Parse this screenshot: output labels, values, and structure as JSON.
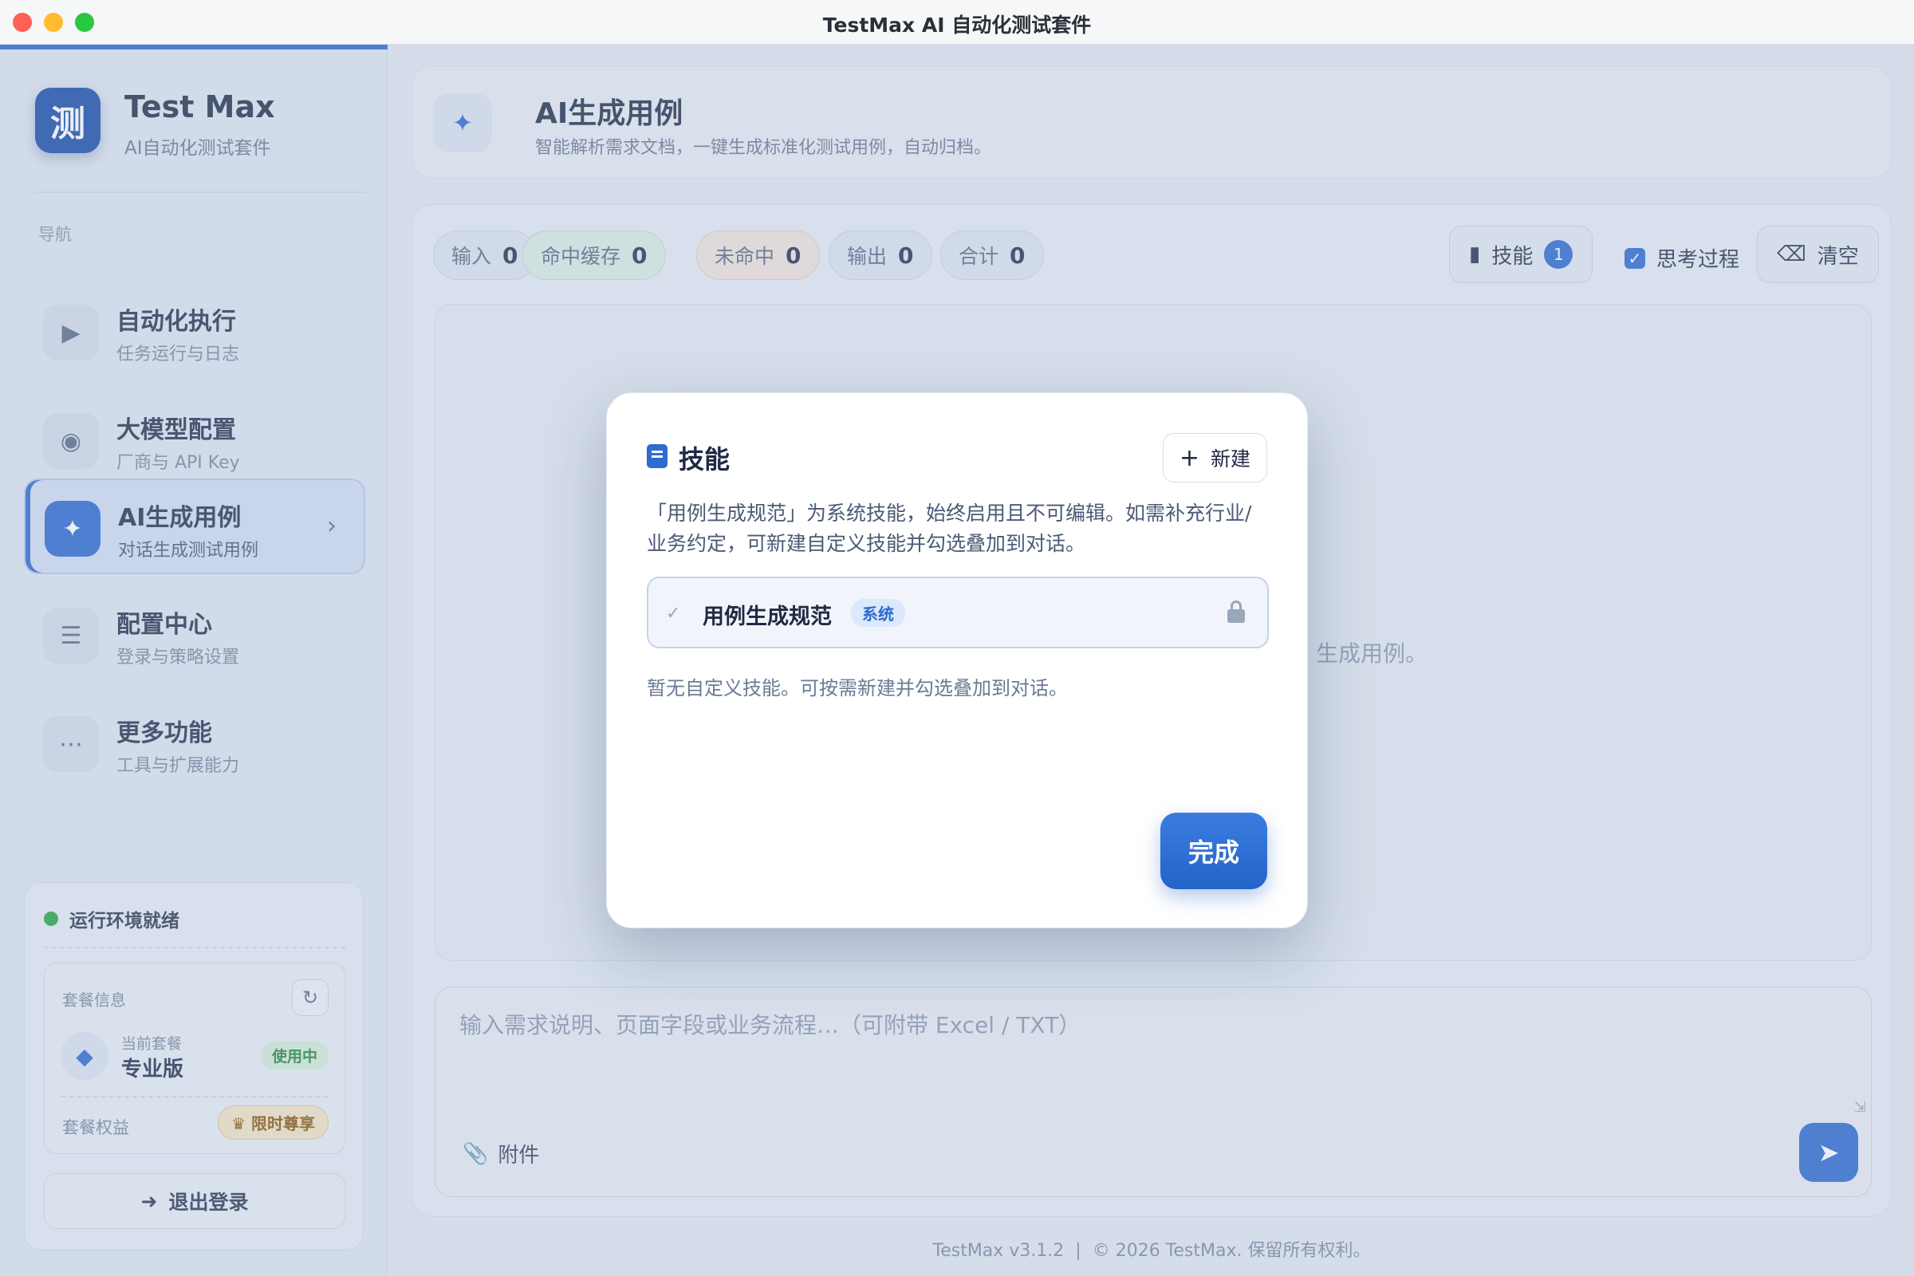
{
  "window": {
    "title": "TestMax AI 自动化测试套件"
  },
  "brand": {
    "logo_glyph": "测",
    "name": "Test Max",
    "subtitle": "AI自动化测试套件"
  },
  "sidebar": {
    "caption": "导航",
    "items": [
      {
        "title": "自动化执行",
        "sub": "任务运行与日志",
        "icon": "play-icon",
        "active": false
      },
      {
        "title": "大模型配置",
        "sub": "厂商与 API Key",
        "icon": "brain-icon",
        "active": false
      },
      {
        "title": "AI生成用例",
        "sub": "对话生成测试用例",
        "icon": "magic-wand-icon",
        "active": true
      },
      {
        "title": "配置中心",
        "sub": "登录与策略设置",
        "icon": "sliders-icon",
        "active": false
      },
      {
        "title": "更多功能",
        "sub": "工具与扩展能力",
        "icon": "more-dots-icon",
        "active": false
      }
    ]
  },
  "status": {
    "text": "运行环境就绪",
    "plan_caption": "套餐信息",
    "plan_label": "当前套餐",
    "plan_value": "专业版",
    "plan_badge": "使用中",
    "benefit_label": "套餐权益",
    "vip_label": "限时尊享",
    "logout_label": "退出登录"
  },
  "header": {
    "title": "AI生成用例",
    "subtitle": "智能解析需求文档，一键生成标准化测试用例，自动归档。"
  },
  "stats": [
    {
      "label": "输入",
      "value": "0"
    },
    {
      "label": "命中缓存",
      "value": "0"
    },
    {
      "label": "未命中",
      "value": "0"
    },
    {
      "label": "输出",
      "value": "0"
    },
    {
      "label": "合计",
      "value": "0"
    }
  ],
  "toolbar": {
    "skills_label": "技能",
    "skills_count": "1",
    "think_label": "思考过程",
    "clear_label": "清空"
  },
  "chat": {
    "hint": "生成用例。"
  },
  "composer": {
    "placeholder": "输入需求说明、页面字段或业务流程…（可附带 Excel / TXT）",
    "attach_label": "附件"
  },
  "footer": {
    "version": "TestMax v3.1.2",
    "copyright": "© 2026 TestMax. 保留所有权利。"
  },
  "modal": {
    "title": "技能",
    "new_label": "新建",
    "description": "「用例生成规范」为系统技能，始终启用且不可编辑。如需补充行业/业务约定，可新建自定义技能并勾选叠加到对话。",
    "skill_name": "用例生成规范",
    "skill_tag": "系统",
    "empty_hint": "暂无自定义技能。可按需新建并勾选叠加到对话。",
    "done_label": "完成"
  },
  "colors": {
    "accent": "#2f6bd0",
    "success": "#2aa44a"
  }
}
